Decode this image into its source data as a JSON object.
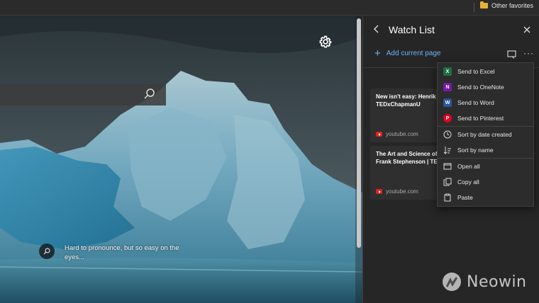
{
  "favorites_bar": {
    "folder_label": "Other favorites"
  },
  "page": {
    "caption": "Hard to pronounce, but so easy on the eyes..."
  },
  "panel": {
    "title": "Watch List",
    "add_current_page": "Add current page",
    "more_label": "···",
    "cards": [
      {
        "title": "New isn't easy: Henrik F\nTEDxChapmanU",
        "site": "youtube.com"
      },
      {
        "title": "The Art and Science of\nFrank Stephenson | TED",
        "site": "youtube.com"
      }
    ]
  },
  "context_menu": {
    "items": [
      {
        "label": "Send to Excel",
        "icon": "excel-icon",
        "glyph": "X",
        "color": "#1d6f42"
      },
      {
        "label": "Send to OneNote",
        "icon": "onenote-icon",
        "glyph": "N",
        "color": "#7719aa"
      },
      {
        "label": "Send to Word",
        "icon": "word-icon",
        "glyph": "W",
        "color": "#2b579a"
      },
      {
        "label": "Send to Pinterest",
        "icon": "pinterest-icon",
        "glyph": "P",
        "color": "#e60023"
      },
      {
        "label": "Sort by date created",
        "icon": "clock-icon"
      },
      {
        "label": "Sort by name",
        "icon": "sort-icon"
      },
      {
        "label": "Open all",
        "icon": "open-window-icon"
      },
      {
        "label": "Copy all",
        "icon": "copy-icon"
      },
      {
        "label": "Paste",
        "icon": "paste-icon"
      }
    ]
  },
  "watermark": {
    "text": "Neowin"
  },
  "colors": {
    "accent": "#6db5ff",
    "panel_bg": "#262626",
    "menu_bg": "#2c2c2c"
  }
}
